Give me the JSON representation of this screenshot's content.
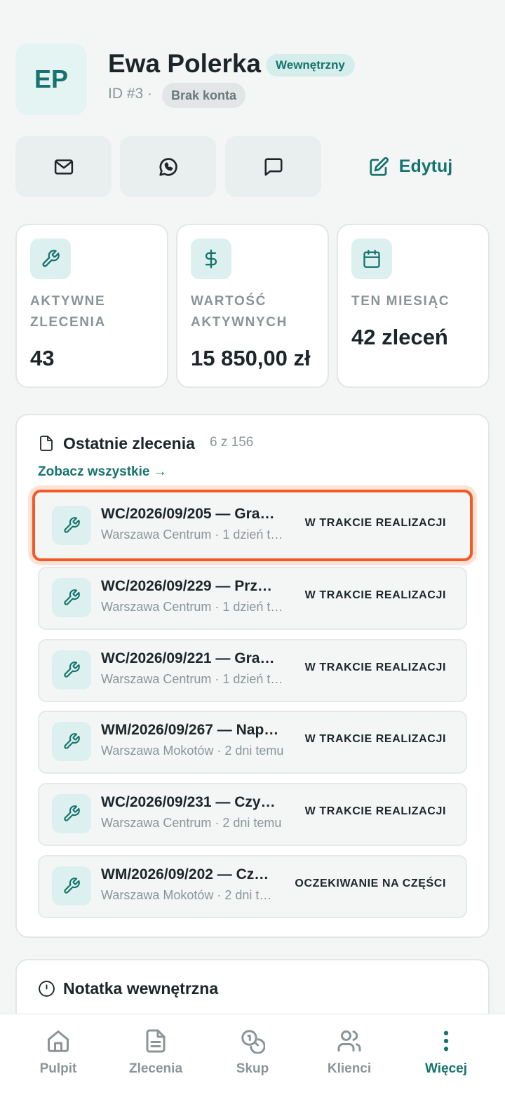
{
  "profile": {
    "initials": "EP",
    "name": "Ewa Polerka",
    "type_badge": "Wewnętrzny",
    "id_text": "ID #3 ·",
    "account_badge": "Brak konta"
  },
  "actions": {
    "email_icon": "mail-icon",
    "whatsapp_icon": "whatsapp-icon",
    "sms_icon": "message-icon",
    "edit_label": "Edytuj"
  },
  "stats": [
    {
      "label": "AKTYWNE ZLECENIA",
      "value": "43",
      "icon": "wrench-icon"
    },
    {
      "label": "WARTOŚĆ AKTYWNYCH",
      "value": "15 850,00 zł",
      "icon": "dollar-icon"
    },
    {
      "label": "TEN MIESIĄC",
      "value": "42 zleceń",
      "icon": "calendar-icon"
    }
  ],
  "recent": {
    "title": "Ostatnie zlecenia",
    "count": "6 z 156",
    "see_all": "Zobacz wszystkie →",
    "orders": [
      {
        "title": "WC/2026/09/205 — Gra…",
        "subtitle": "Warszawa Centrum · 1 dzień t…",
        "status": "W TRAKCIE REALIZACJI"
      },
      {
        "title": "WC/2026/09/229 — Prz…",
        "subtitle": "Warszawa Centrum · 1 dzień t…",
        "status": "W TRAKCIE REALIZACJI"
      },
      {
        "title": "WC/2026/09/221 — Gra…",
        "subtitle": "Warszawa Centrum · 1 dzień t…",
        "status": "W TRAKCIE REALIZACJI"
      },
      {
        "title": "WM/2026/09/267 — Nap…",
        "subtitle": "Warszawa Mokotów · 2 dni temu",
        "status": "W TRAKCIE REALIZACJI"
      },
      {
        "title": "WC/2026/09/231 — Czy…",
        "subtitle": "Warszawa Centrum · 2 dni temu",
        "status": "W TRAKCIE REALIZACJI"
      },
      {
        "title": "WM/2026/09/202 — Cz…",
        "subtitle": "Warszawa Mokotów · 2 dni t…",
        "status": "OCZEKIWANIE NA CZĘŚCI"
      }
    ]
  },
  "note": {
    "title": "Notatka wewnętrzna"
  },
  "nav": [
    {
      "label": "Pulpit",
      "icon": "home-icon"
    },
    {
      "label": "Zlecenia",
      "icon": "document-icon"
    },
    {
      "label": "Skup",
      "icon": "coins-icon"
    },
    {
      "label": "Klienci",
      "icon": "users-icon"
    },
    {
      "label": "Więcej",
      "icon": "more-vertical-icon",
      "active": true
    }
  ],
  "colors": {
    "accent": "#17736d",
    "highlight": "#f15a24",
    "background": "#f4f6f6"
  }
}
